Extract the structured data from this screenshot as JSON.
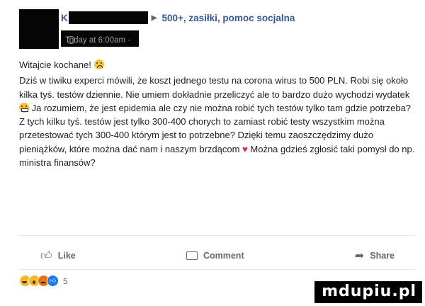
{
  "header": {
    "name_initial": "K",
    "group_name": "500+, zasiłki, pomoc socjalna",
    "timestamp": "Today at 6:00am ·"
  },
  "post": {
    "greeting": "Witajcie kochane!",
    "body_1": "Dziś w tiwiku experci mówili, że koszt jednego testu na corona wirus to 500 PLN. Robi się około kilka tyś. testów dziennie. Nie umiem dokładnie przeliczyć ale to bardzo dużo wychodzi wydatek",
    "body_2": "Ja rozumiem, że jest epidemia ale czy nie można robić tych testów tylko tam gdzie potrzeba? Z tych kilku tyś. testów jest tylko 300-400 chorych to zamiast robić testy wszystkim można przetestować tych 300-400 którym jest to potrzebne? Dzięki temu zaoszczędzimy dużo pieniążków, które można dać nam i naszym brzdącom",
    "body_3": "Można gdzieś zgłosić taki pomysł do np. ministra finansów?"
  },
  "actions": {
    "like": "Like",
    "comment": "Comment",
    "share": "Share"
  },
  "reactions": {
    "count": "5"
  },
  "watermark": "mdupiu.pl"
}
